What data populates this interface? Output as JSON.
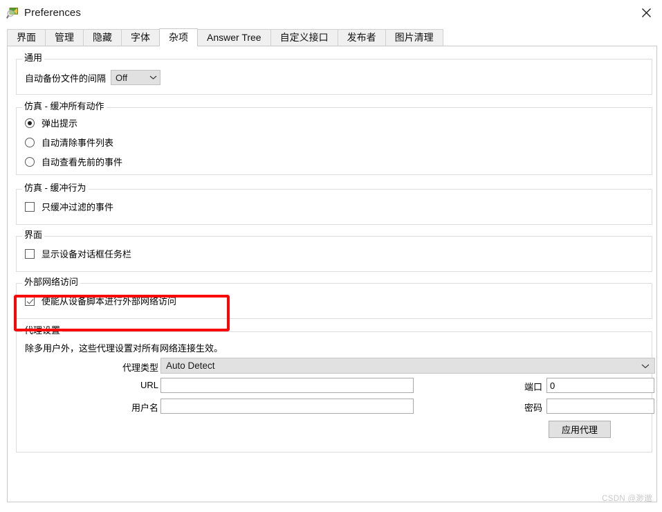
{
  "window": {
    "title": "Preferences",
    "icon": "magnifier-package-icon",
    "close_label": "✕"
  },
  "tabs": [
    {
      "label": "界面",
      "selected": false
    },
    {
      "label": "管理",
      "selected": false
    },
    {
      "label": "隐藏",
      "selected": false
    },
    {
      "label": "字体",
      "selected": false
    },
    {
      "label": "杂项",
      "selected": true
    },
    {
      "label": "Answer Tree",
      "selected": false
    },
    {
      "label": "自定义接口",
      "selected": false
    },
    {
      "label": "发布者",
      "selected": false
    },
    {
      "label": "图片清理",
      "selected": false
    }
  ],
  "groups": {
    "general": {
      "legend": "通用",
      "backup_label": "自动备份文件的间隔",
      "backup_value": "Off"
    },
    "sim_buffer_all": {
      "legend": "仿真 - 缓冲所有动作",
      "options": [
        {
          "label": "弹出提示",
          "checked": true
        },
        {
          "label": "自动清除事件列表",
          "checked": false
        },
        {
          "label": "自动查看先前的事件",
          "checked": false
        }
      ]
    },
    "sim_buffer_behavior": {
      "legend": "仿真 - 缓冲行为",
      "checkbox": {
        "label": "只缓冲过滤的事件",
        "checked": false
      }
    },
    "interface": {
      "legend": "界面",
      "checkbox": {
        "label": "显示设备对话框任务栏",
        "checked": false
      }
    },
    "external_network": {
      "legend": "外部网络访问",
      "checkbox": {
        "label": "使能从设备脚本进行外部网络访问",
        "checked": true
      }
    },
    "proxy": {
      "legend": "代理设置",
      "description": "除多用户外，这些代理设置对所有网络连接生效。",
      "type_label": "代理类型",
      "type_value": "Auto Detect",
      "url_label": "URL",
      "url_value": "",
      "username_label": "用户名",
      "username_value": "",
      "port_label": "端口",
      "port_value": "0",
      "password_label": "密码",
      "password_value": "",
      "apply_button": "应用代理"
    }
  },
  "annotation": {
    "highlight_color": "#fb0505"
  },
  "watermark": "CSDN @渺邈"
}
